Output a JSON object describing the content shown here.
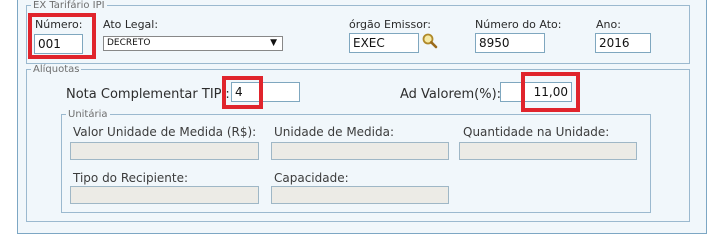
{
  "ex_tarifario": {
    "legend": "EX Tarifário IPI",
    "numero": {
      "label": "Número:",
      "value": "001"
    },
    "ato_legal": {
      "label": "Ato Legal:",
      "value": "DECRETO"
    },
    "orgao_emissor": {
      "label": "órgão Emissor:",
      "value": "EXEC"
    },
    "numero_ato": {
      "label": "Número do Ato:",
      "value": "8950"
    },
    "ano": {
      "label": "Ano:",
      "value": "2016"
    }
  },
  "aliquotas": {
    "legend": "Alíquotas",
    "nota_complementar": {
      "label": "Nota Complementar TIPI:",
      "value": "4"
    },
    "ad_valorem": {
      "label": "Ad Valorem(%):",
      "value": "11,00"
    }
  },
  "unitaria": {
    "legend": "Unitária",
    "valor_unidade": {
      "label": "Valor Unidade de Medida (R$):",
      "value": ""
    },
    "unidade_medida": {
      "label": "Unidade de Medida:",
      "value": ""
    },
    "quantidade_unidade": {
      "label": "Quantidade na Unidade:",
      "value": ""
    },
    "tipo_recipiente": {
      "label": "Tipo do Recipiente:",
      "value": ""
    },
    "capacidade": {
      "label": "Capacidade:",
      "value": ""
    }
  },
  "colors": {
    "highlight": "#e0242c",
    "border": "#7fa7bf",
    "panel": "#f1f7fb"
  },
  "icons": {
    "search": "magnifier-icon"
  }
}
